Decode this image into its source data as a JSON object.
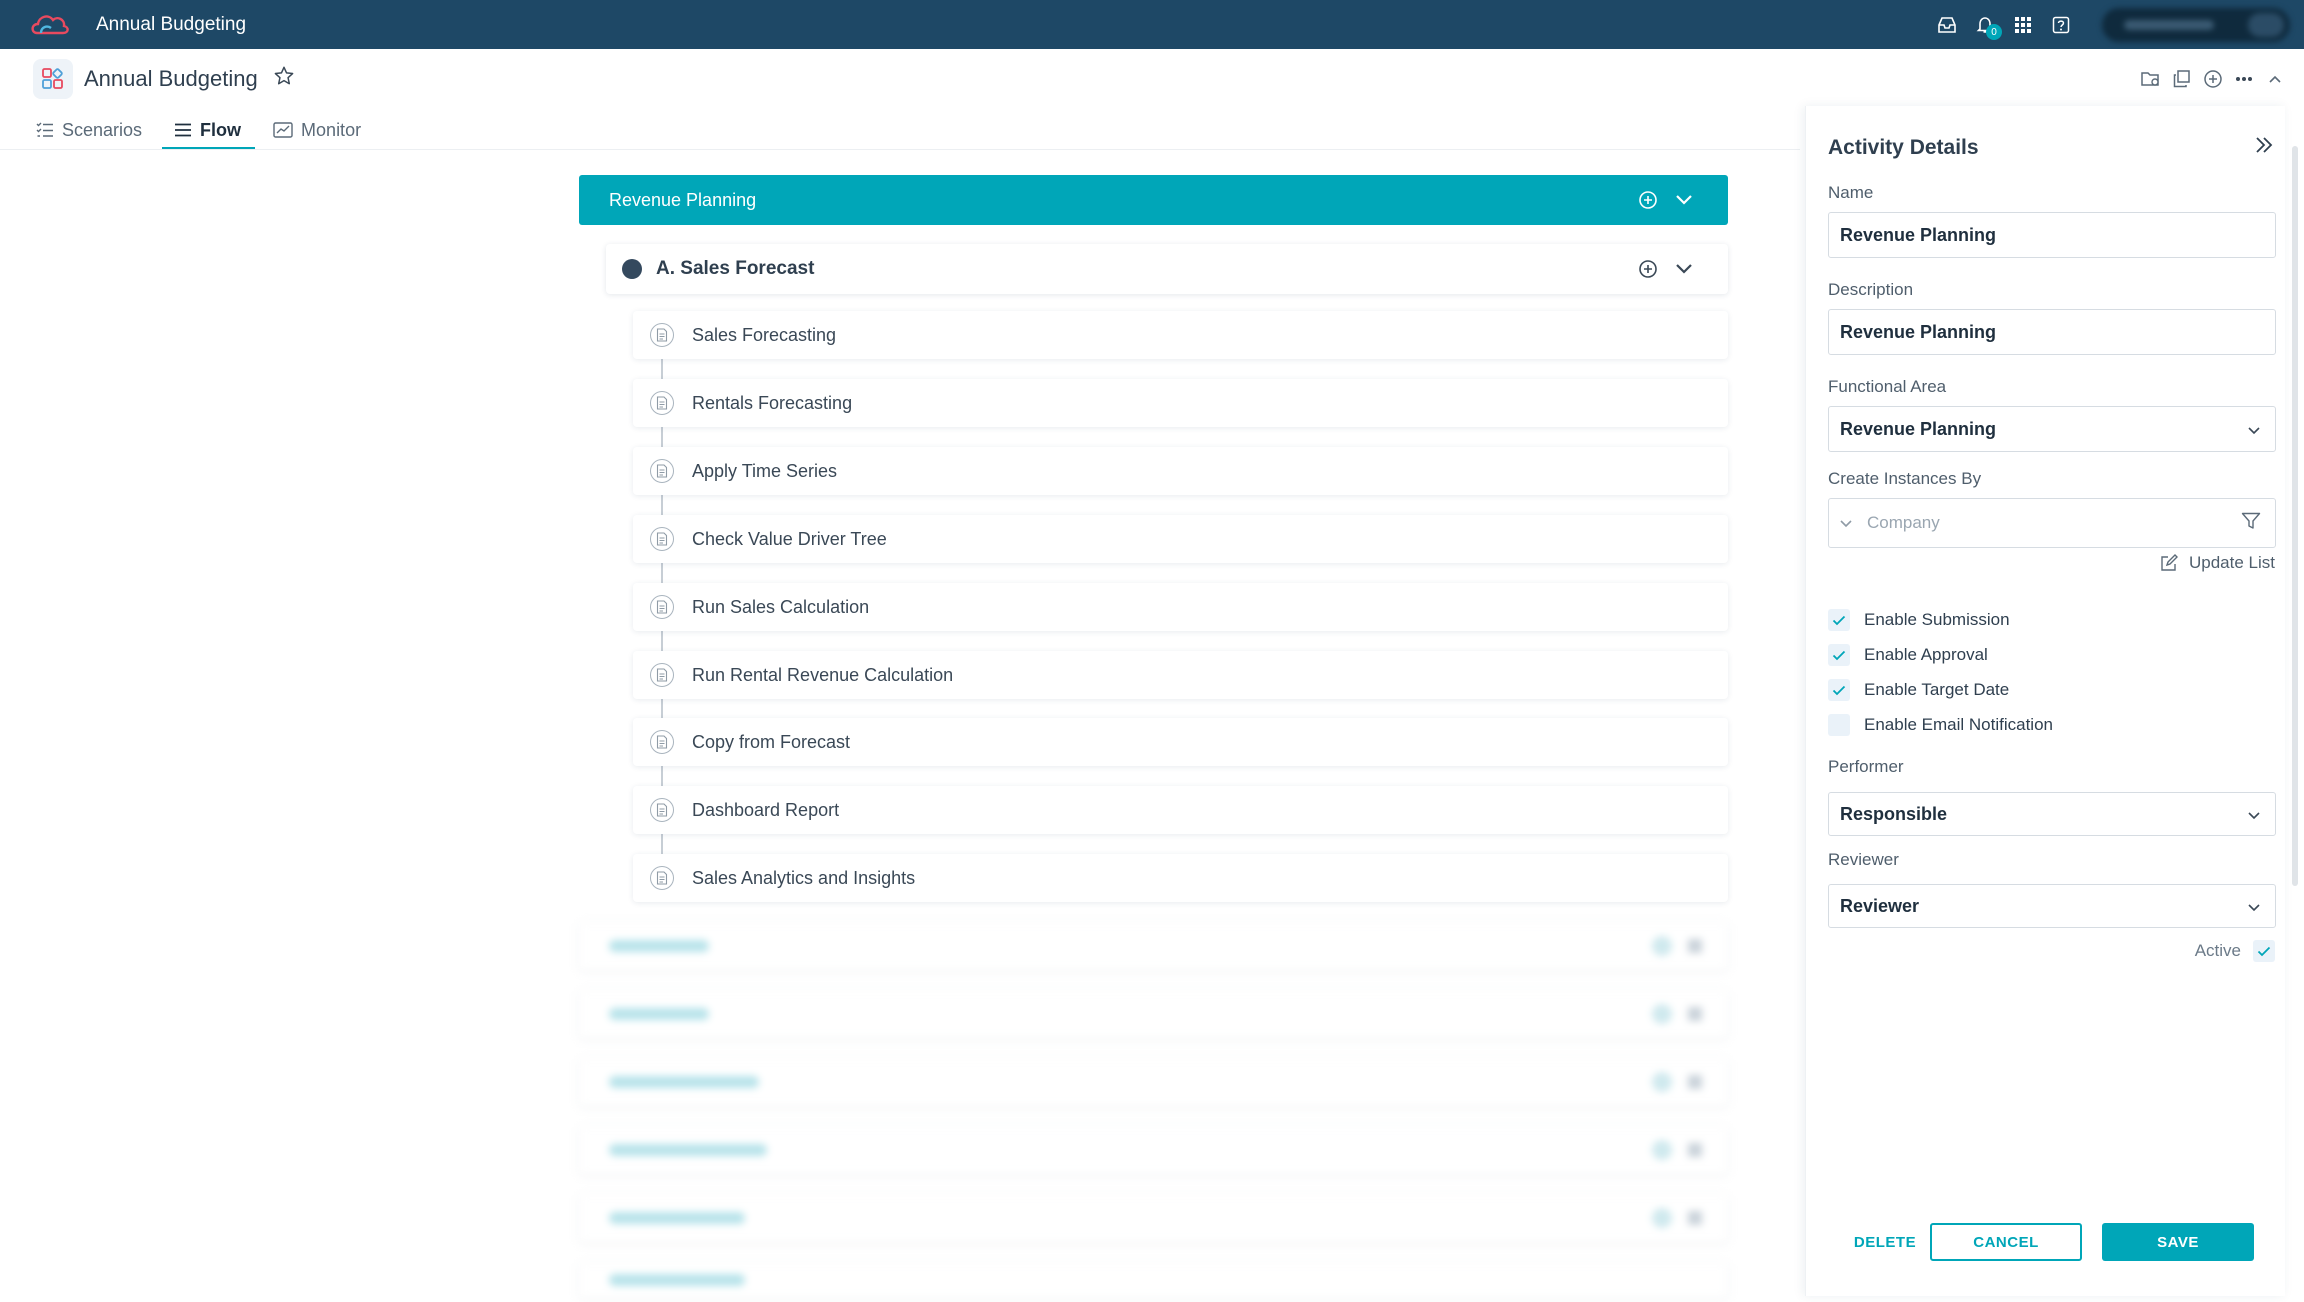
{
  "app": {
    "title": "Annual Budgeting",
    "notification_count": "0"
  },
  "page": {
    "title": "Annual Budgeting"
  },
  "tabs": [
    {
      "label": "Scenarios",
      "active": false
    },
    {
      "label": "Flow",
      "active": true
    },
    {
      "label": "Monitor",
      "active": false
    }
  ],
  "flow": {
    "section": "Revenue Planning",
    "group": "A. Sales Forecast",
    "activities": [
      "Sales Forecasting",
      "Rentals Forecasting",
      "Apply Time Series",
      "Check Value Driver Tree",
      "Run Sales Calculation",
      "Run Rental Revenue Calculation",
      "Copy from Forecast",
      "Dashboard Report",
      "Sales Analytics and Insights"
    ]
  },
  "panel": {
    "title": "Activity Details",
    "name_label": "Name",
    "name_value": "Revenue Planning",
    "description_label": "Description",
    "description_value": "Revenue Planning",
    "functional_area_label": "Functional Area",
    "functional_area_value": "Revenue Planning",
    "create_instances_label": "Create Instances By",
    "create_instances_placeholder": "Company",
    "update_list_label": "Update List",
    "checkboxes": [
      {
        "label": "Enable Submission",
        "checked": true
      },
      {
        "label": "Enable Approval",
        "checked": true
      },
      {
        "label": "Enable Target Date",
        "checked": true
      },
      {
        "label": "Enable Email Notification",
        "checked": false
      }
    ],
    "performer_label": "Performer",
    "performer_value": "Responsible",
    "reviewer_label": "Reviewer",
    "reviewer_value": "Reviewer",
    "active_label": "Active",
    "active_checked": true,
    "delete_label": "DELETE",
    "cancel_label": "CANCEL",
    "save_label": "SAVE"
  },
  "colors": {
    "accent": "#00a6b8",
    "topbar": "#1e4866",
    "text_dark": "#2f3f4f"
  }
}
